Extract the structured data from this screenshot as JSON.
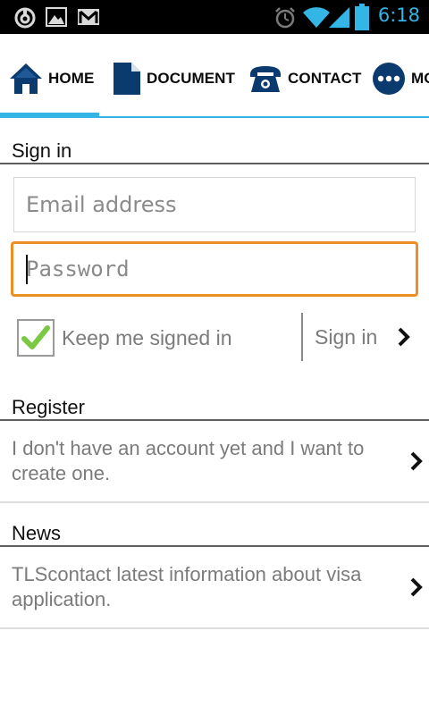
{
  "status_bar": {
    "time": "6:18",
    "icons": [
      "sync-icon",
      "gallery-icon",
      "gmail-icon",
      "alarm-icon",
      "wifi-icon",
      "signal-icon",
      "battery-icon"
    ],
    "accent_color": "#33b5e5"
  },
  "tabs": [
    {
      "label": "HOME",
      "icon": "home-icon",
      "active": true
    },
    {
      "label": "DOCUMENT",
      "icon": "document-icon",
      "active": false
    },
    {
      "label": "CONTACT",
      "icon": "phone-icon",
      "active": false
    },
    {
      "label": "MO",
      "icon": "more-icon",
      "active": false
    }
  ],
  "signin": {
    "title": "Sign in",
    "email_placeholder": "Email address",
    "password_placeholder": "Password",
    "keep_signed_in_label": "Keep me signed in",
    "keep_signed_in_checked": true,
    "submit_label": "Sign in"
  },
  "register": {
    "title": "Register",
    "description": "I don't have an account yet and I want to create one."
  },
  "news": {
    "title": "News",
    "description": "TLScontact latest information about visa application."
  },
  "colors": {
    "focus_orange": "#ee8f26",
    "brand_navy": "#0b3a6e",
    "check_green": "#7ac943"
  }
}
